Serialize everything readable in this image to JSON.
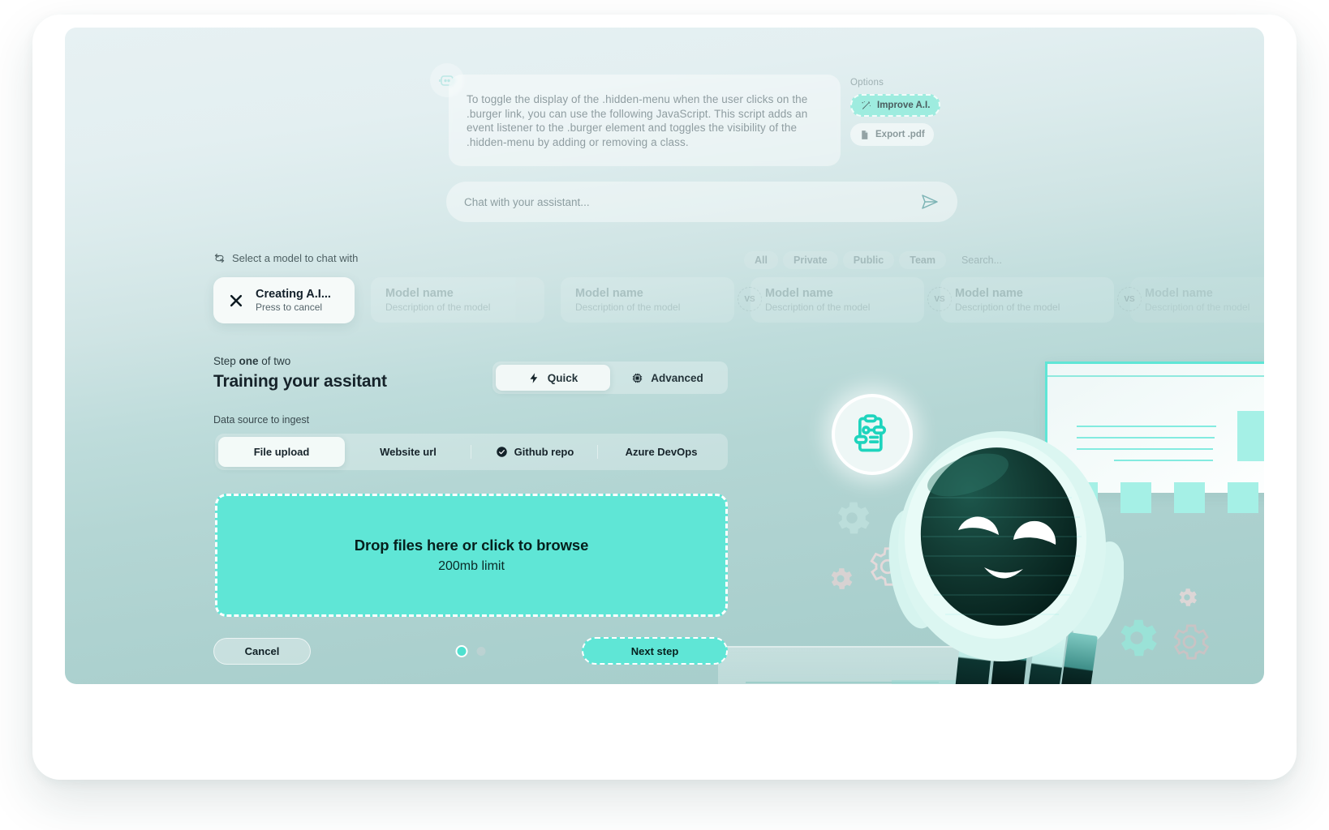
{
  "chat": {
    "avatar_icon": "robot-icon",
    "message": "To toggle the display of the .hidden-menu when the user clicks on the .burger link, you can use the following JavaScript. This script adds an event listener to the .burger element and toggles the visibility of the .hidden-menu by adding or removing a class.",
    "input_placeholder": "Chat with your assistant...",
    "send_icon": "send-icon"
  },
  "options": {
    "label": "Options",
    "items": [
      {
        "label": "Improve A.I.",
        "icon": "magic-wand-icon",
        "active": true
      },
      {
        "label": "Export .pdf",
        "icon": "document-icon",
        "active": false
      }
    ]
  },
  "model_picker": {
    "heading": "Select a model to chat with",
    "heading_icon": "refresh-icon",
    "filters": [
      "All",
      "Private",
      "Public",
      "Team",
      "Search..."
    ],
    "creating_card": {
      "title": "Creating A.I...",
      "subtitle": "Press to cancel",
      "icon": "close-icon"
    },
    "cards": [
      {
        "name": "Model name",
        "description": "Description of the model",
        "badge": ""
      },
      {
        "name": "Model name",
        "description": "Description of the model",
        "badge": "VS"
      },
      {
        "name": "Model name",
        "description": "Description of the model",
        "badge": "VS"
      },
      {
        "name": "Model name",
        "description": "Description of the model",
        "badge": "VS"
      },
      {
        "name": "Model name",
        "description": "Description of the model",
        "badge": ""
      }
    ]
  },
  "wizard": {
    "step_prefix": "Step ",
    "step_current": "one",
    "step_suffix": " of two",
    "title": "Training your assitant",
    "mode_toggle": [
      {
        "label": "Quick",
        "icon": "lightning-icon",
        "active": true
      },
      {
        "label": "Advanced",
        "icon": "cpu-chip-icon",
        "active": false
      }
    ],
    "data_source_label": "Data source to ingest",
    "data_source_tabs": [
      {
        "label": "File upload",
        "icon": "",
        "active": true
      },
      {
        "label": "Website url",
        "icon": "",
        "active": false
      },
      {
        "label": "Github repo",
        "icon": "check-circle-icon",
        "active": false
      },
      {
        "label": "Azure DevOps",
        "icon": "",
        "active": false
      }
    ],
    "dropzone": {
      "headline": "Drop files here or click to browse",
      "sublabel": "200mb limit"
    },
    "cancel_label": "Cancel",
    "next_label": "Next step",
    "step_dots": 2,
    "step_dot_active_index": 0
  },
  "colors": {
    "accent_teal": "#5fe6d6",
    "accent_light": "#9eecdf",
    "robot_dark": "#0d302b",
    "background_top": "#e7f1f3",
    "background_bottom": "#a5cdca"
  },
  "illustration": {
    "badge_icon": "clipboard-workflow-icon",
    "mascot": "robot-mascot",
    "gears": [
      "gear-icon",
      "gear-icon",
      "gear-icon",
      "gear-icon",
      "gear-icon"
    ]
  }
}
